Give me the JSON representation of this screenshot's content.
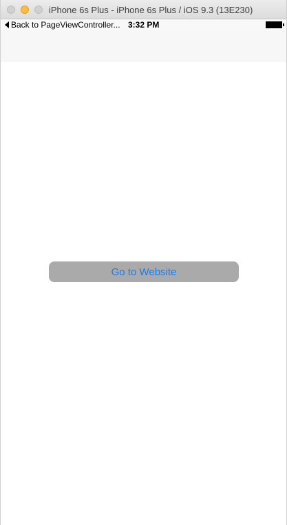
{
  "window": {
    "title": "iPhone 6s Plus - iPhone 6s Plus / iOS 9.3 (13E230)"
  },
  "status_bar": {
    "back_label": "Back to PageViewController...",
    "time": "3:32 PM",
    "battery_icon": "battery-full-icon"
  },
  "main": {
    "button_label": "Go to Website",
    "button_color": "#aaaaaa",
    "button_text_color": "#1a7cf0"
  }
}
